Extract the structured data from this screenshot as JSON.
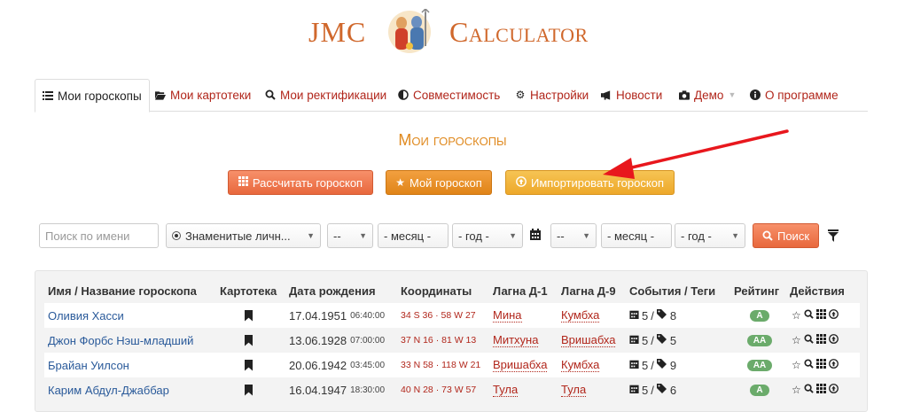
{
  "logo": {
    "left": "JMC",
    "right": "Calculator"
  },
  "nav": [
    {
      "label": "Мои гороскопы",
      "icon": "list-icon",
      "active": true
    },
    {
      "label": "Мои картотеки",
      "icon": "folder-open-icon"
    },
    {
      "label": "Мои ректификации",
      "icon": "zoom-icon"
    },
    {
      "label": "Совместимость",
      "icon": "half-circle-icon"
    },
    {
      "label": "Настройки",
      "icon": "gear-icon"
    },
    {
      "label": "Новости",
      "icon": "bullhorn-icon"
    },
    {
      "label": "Демо",
      "icon": "camera-icon"
    },
    {
      "label": "О программе",
      "icon": "info-icon"
    }
  ],
  "page_title": "Мои гороскопы",
  "buttons": {
    "calc": "Рассчитать гороскоп",
    "my": "Мой гороскоп",
    "import": "Импортировать гороскоп"
  },
  "filters": {
    "search_placeholder": "Поиск по имени",
    "category": "Знаменитые личн...",
    "day1": "--",
    "month1": "- месяц -",
    "year1": "- год -",
    "day2": "--",
    "month2": "- месяц -",
    "year2": "- год -",
    "search_button": "Поиск"
  },
  "table": {
    "headers": [
      "Имя / Название гороскопа",
      "Картотека",
      "Дата рождения",
      "Координаты",
      "Лагна Д-1",
      "Лагна Д-9",
      "События / Теги",
      "Рейтинг",
      "Действия"
    ],
    "rows": [
      {
        "name": "Оливия Хасси",
        "date": "17.04.1951",
        "time": "06:40:00",
        "coords": "34 S 36 · 58 W 27",
        "lagna1": "Мина",
        "lagna9": "Кумбха",
        "events": "5",
        "tags": "8",
        "rating": "A"
      },
      {
        "name": "Джон Форбс Нэш-младший",
        "date": "13.06.1928",
        "time": "07:00:00",
        "coords": "37 N 16 · 81 W 13",
        "lagna1": "Митхуна",
        "lagna9": "Вришабха",
        "events": "5",
        "tags": "5",
        "rating": "AA"
      },
      {
        "name": "Брайан Уилсон",
        "date": "20.06.1942",
        "time": "03:45:00",
        "coords": "33 N 58 · 118 W 21",
        "lagna1": "Вришабха",
        "lagna9": "Кумбха",
        "events": "5",
        "tags": "9",
        "rating": "AA"
      },
      {
        "name": "Карим Абдул-Джаббар",
        "date": "16.04.1947",
        "time": "18:30:00",
        "coords": "40 N 28 · 73 W 57",
        "lagna1": "Тула",
        "lagna9": "Тула",
        "events": "5",
        "tags": "6",
        "rating": "A"
      }
    ]
  },
  "colors": {
    "brand": "#d0682c",
    "link": "#b1261b",
    "name_link": "#2a5a9a",
    "badge": "#6bab6b",
    "arrow": "#e8171d"
  }
}
